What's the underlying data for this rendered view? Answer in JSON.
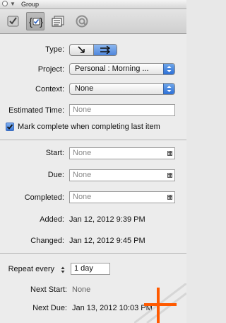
{
  "window": {
    "title": "Group"
  },
  "toolbar": {
    "tools": [
      {
        "name": "status-checkbox-tool"
      },
      {
        "name": "inspector-tool"
      },
      {
        "name": "note-tool"
      },
      {
        "name": "attachment-tool"
      }
    ]
  },
  "type": {
    "label": "Type:"
  },
  "project": {
    "label": "Project:",
    "value": "Personal : Morning ..."
  },
  "context": {
    "label": "Context:",
    "value": "None"
  },
  "estimated_time": {
    "label": "Estimated Time:",
    "placeholder": "None"
  },
  "complete_last": {
    "label": "Mark complete when completing last item",
    "checked": true
  },
  "start": {
    "label": "Start:",
    "placeholder": "None"
  },
  "due": {
    "label": "Due:",
    "placeholder": "None"
  },
  "completed": {
    "label": "Completed:",
    "placeholder": "None"
  },
  "added": {
    "label": "Added:",
    "value": "Jan 12, 2012 9:39 PM"
  },
  "changed": {
    "label": "Changed:",
    "value": "Jan 12, 2012 9:45 PM"
  },
  "repeat": {
    "label": "Repeat every",
    "value": "1 day"
  },
  "next_start": {
    "label": "Next Start:",
    "value": "None"
  },
  "next_due": {
    "label": "Next Due:",
    "value": "Jan 13, 2012 10:03 PM"
  },
  "colors": {
    "accent": "#3a78d8",
    "orange": "#ff5a00"
  }
}
